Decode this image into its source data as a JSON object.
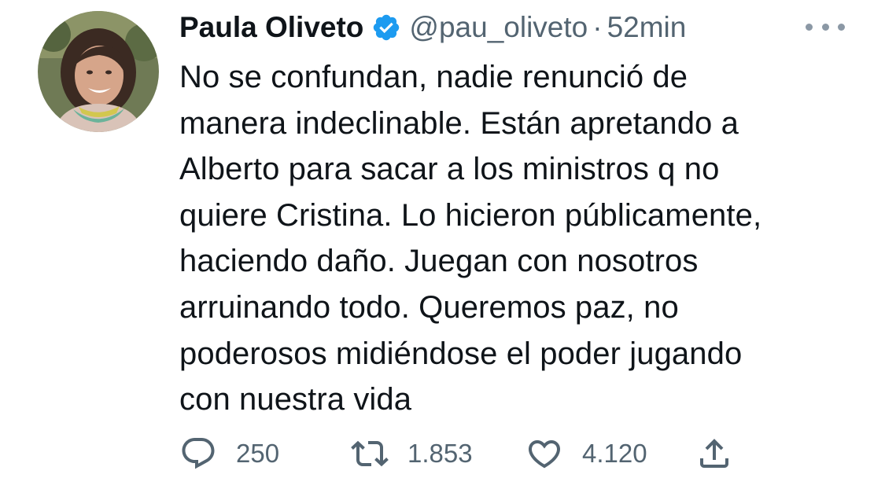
{
  "author": {
    "display_name": "Paula Oliveto",
    "handle": "@pau_oliveto",
    "separator": "·",
    "time": "52min",
    "verified": true
  },
  "tweet": {
    "lines": [
      "No se confundan, nadie renunció de",
      "manera indeclinable. Están apretando a",
      "Alberto para sacar a los ministros q no",
      "quiere Cristina. Lo hicieron públicamente,",
      "haciendo daño. Juegan con nosotros",
      "arruinando todo. Queremos paz, no",
      "poderosos midiéndose el poder jugando",
      "con nuestra vida"
    ]
  },
  "actions": {
    "replies": "250",
    "retweets": "1.853",
    "likes": "4.120"
  },
  "icons": {
    "verified": "verified-badge-icon",
    "more": "more-options-icon",
    "reply": "reply-icon",
    "retweet": "retweet-icon",
    "like": "heart-icon",
    "share": "share-icon"
  },
  "colors": {
    "text": "#0f1419",
    "secondary": "#536471",
    "verified": "#1d9bf0"
  }
}
